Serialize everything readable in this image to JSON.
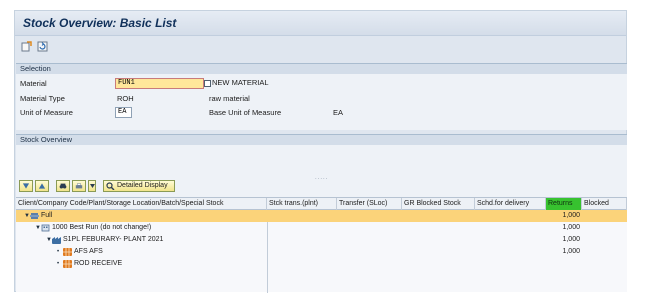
{
  "title": "Stock Overview: Basic List",
  "selection": {
    "header": "Selection",
    "material_label": "Material",
    "material_value": "FUN1",
    "material_desc": "NEW MATERIAL",
    "type_label": "Material Type",
    "type_value": "ROH",
    "type_desc": "raw material",
    "uom_label": "Unit of Measure",
    "uom_value": "EA",
    "base_uom_label": "Base Unit of Measure",
    "base_uom_value": "EA"
  },
  "overview": {
    "header": "Stock Overview",
    "detailed_display": "Detailed Display",
    "sash_dots": "....."
  },
  "grid": {
    "columns": [
      "Client/Company Code/Plant/Storage Location/Batch/Special Stock",
      "Stck trans.(plnt)",
      "Transfer (SLoc)",
      "GR Blocked Stock",
      "Schd.for delivery",
      "Returns",
      "Blocked"
    ],
    "rows": [
      {
        "label": "Full",
        "returns": "1,000",
        "selected": true,
        "level": 0,
        "icon": "stack-icon"
      },
      {
        "label": "1000 Best Run (do not change!)",
        "returns": "1,000",
        "selected": false,
        "level": 1,
        "icon": "company-icon"
      },
      {
        "label": "S1PL FEBURARY- PLANT 2021",
        "returns": "1,000",
        "selected": false,
        "level": 2,
        "icon": "plant-icon"
      },
      {
        "label": "AFS AFS",
        "returns": "1,000",
        "selected": false,
        "level": 3,
        "icon": "storage-icon"
      },
      {
        "label": "ROD RECEIVE",
        "returns": "",
        "selected": false,
        "level": 3,
        "icon": "storage-icon"
      }
    ]
  },
  "colors": {
    "highlight": "#fbd37a",
    "returns_header": "#37c22f",
    "button": "#f1e48a"
  }
}
